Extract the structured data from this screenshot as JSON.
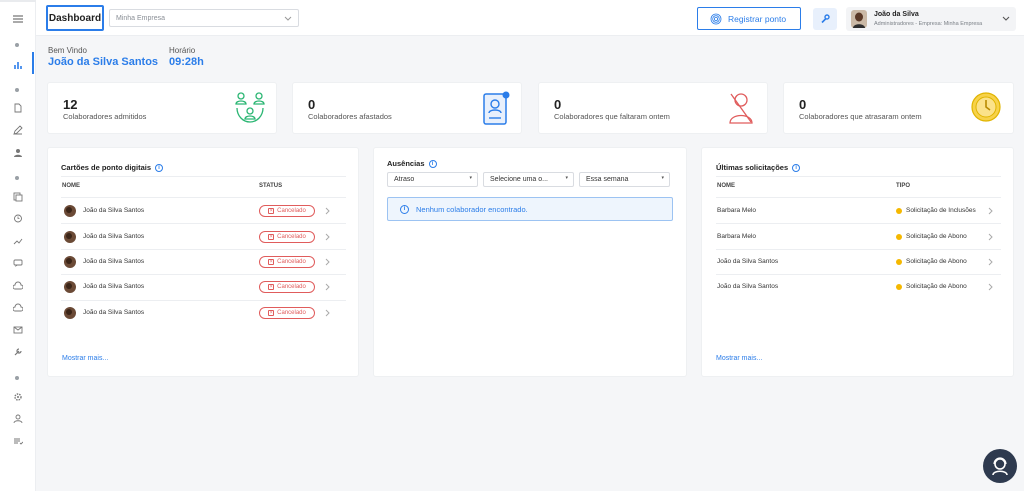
{
  "topbar": {
    "dashboard_label": "Dashboard",
    "company_value": "Minha Empresa",
    "register_label": "Registrar ponto",
    "user_name": "João da Silva",
    "user_sub": "Administradores - Empresa: Minha Empresa"
  },
  "welcome": {
    "greeting_label": "Bem Vindo",
    "greeting_name": "João da Silva Santos",
    "time_label": "Horário",
    "time_value": "09:28h"
  },
  "stats": [
    {
      "value": "12",
      "label": "Colaboradores admitidos",
      "icon": "people-network-icon"
    },
    {
      "value": "0",
      "label": "Colaboradores afastados",
      "icon": "id-badge-icon"
    },
    {
      "value": "0",
      "label": "Colaboradores que faltaram ontem",
      "icon": "user-missing-icon"
    },
    {
      "value": "0",
      "label": "Colaboradores que atrasaram ontem",
      "icon": "clock-coin-icon"
    }
  ],
  "timecards": {
    "title": "Cartões de ponto digitais",
    "col_name": "NOME",
    "col_status": "STATUS",
    "rows": [
      {
        "name": "João da Silva Santos",
        "status": "Cancelado"
      },
      {
        "name": "João da Silva Santos",
        "status": "Cancelado"
      },
      {
        "name": "João da Silva Santos",
        "status": "Cancelado"
      },
      {
        "name": "João da Silva Santos",
        "status": "Cancelado"
      },
      {
        "name": "João da Silva Santos",
        "status": "Cancelado"
      }
    ],
    "more": "Mostrar mais..."
  },
  "absences": {
    "title": "Ausências",
    "filter_type": "Atraso",
    "filter_option": "Selecione uma o...",
    "filter_period": "Essa semana",
    "empty_message": "Nenhum colaborador encontrado."
  },
  "requests": {
    "title": "Últimas solicitações",
    "col_name": "NOME",
    "col_type": "TIPO",
    "rows": [
      {
        "name": "Barbara Melo",
        "type": "Solicitação de Inclusões"
      },
      {
        "name": "Barbara Melo",
        "type": "Solicitação de Abono"
      },
      {
        "name": "João da Silva Santos",
        "type": "Solicitação de Abono"
      },
      {
        "name": "João da Silva Santos",
        "type": "Solicitação de Abono"
      }
    ],
    "more": "Mostrar mais..."
  },
  "colors": {
    "accent": "#2b7de9",
    "danger": "#e05c5c",
    "warning": "#f5b800",
    "success": "#2bb673"
  }
}
